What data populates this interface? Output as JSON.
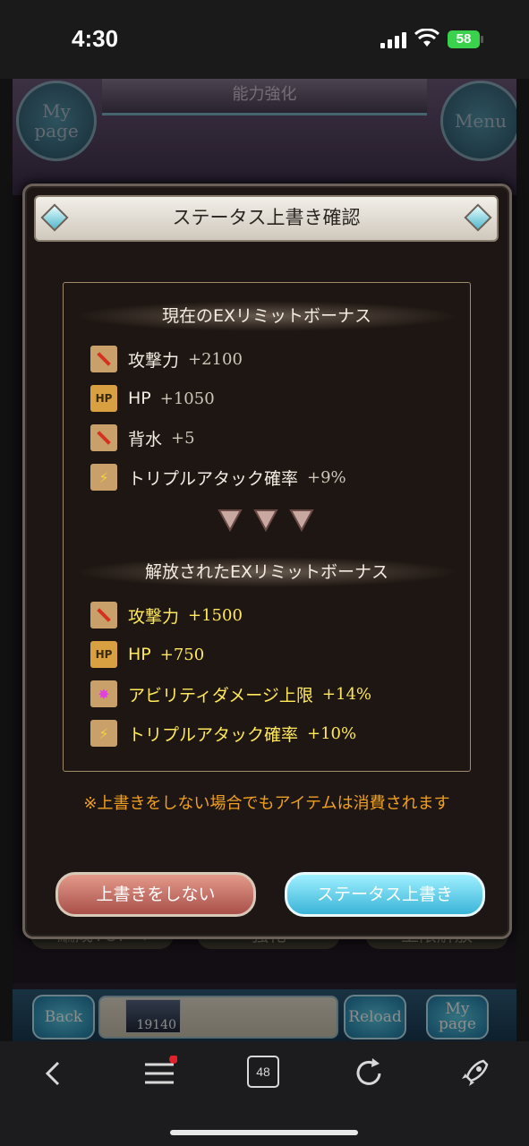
{
  "status_bar": {
    "time": "4:30",
    "battery": "58"
  },
  "game": {
    "title": "能力強化",
    "mypage_label": "My page",
    "menu_label": "Menu",
    "background_toolbar": [
      "編成TOPへ",
      "強化",
      "上限解放"
    ],
    "nav": {
      "back": "Back",
      "reload": "Reload",
      "mypage": "My page",
      "count": "19140"
    }
  },
  "modal": {
    "title": "ステータス上書き確認",
    "current_header": "現在のEXリミットボーナス",
    "current_items": [
      {
        "icon": "attack-icon",
        "name": "攻撃力",
        "value": "+2100"
      },
      {
        "icon": "hp-icon",
        "name": "HP",
        "value": "+1050"
      },
      {
        "icon": "attack-icon",
        "name": "背水",
        "value": "+5"
      },
      {
        "icon": "triple-attack-icon",
        "name": "トリプルアタック確率",
        "value": "+9%"
      }
    ],
    "released_header": "解放されたEXリミットボーナス",
    "released_items": [
      {
        "icon": "attack-icon",
        "name": "攻撃力",
        "value": "+1500"
      },
      {
        "icon": "hp-icon",
        "name": "HP",
        "value": "+750"
      },
      {
        "icon": "ability-damage-icon",
        "name": "アビリティダメージ上限",
        "value": "+14%"
      },
      {
        "icon": "triple-attack-icon",
        "name": "トリプルアタック確率",
        "value": "+10%"
      }
    ],
    "note": "※上書きをしない場合でもアイテムは消費されます",
    "cancel_label": "上書きをしない",
    "confirm_label": "ステータス上書き"
  },
  "browser": {
    "tab_count": "48"
  },
  "colors": {
    "new_value": "#ffe95a",
    "note": "#f0a020",
    "confirm": "#3ab4d8",
    "cancel": "#a8504a"
  }
}
